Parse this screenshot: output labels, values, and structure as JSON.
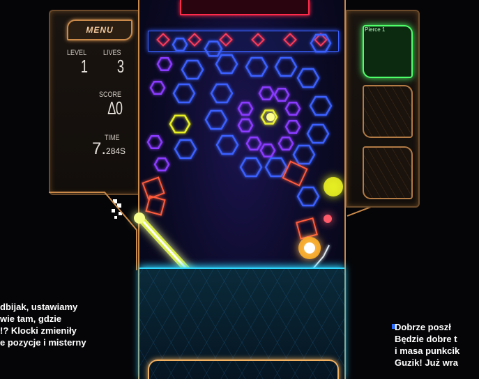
{
  "hud": {
    "menu_label": "MENU",
    "level_label": "LEVEL",
    "level_value": "1",
    "lives_label": "LIVES",
    "lives_value": "3",
    "score_label": "SCORE",
    "score_value": "∆0",
    "time_label": "TIME",
    "time_value_main": "7.",
    "time_value_small": "284S"
  },
  "card": {
    "label": "Pierce 1",
    "icon": "arrow-up-icon"
  },
  "captions": {
    "left": "dbijak, ustawiamy\nwie tam, gdzie\n!? Klocki zmieniły\ne pozycje i misterny",
    "right": "Dobrze poszł\nBędzie dobre t\ni masa punkcik\nGuzik! Już wra"
  },
  "colors": {
    "accent_orange": "#c98a4a",
    "neon_blue": "#3a60ff",
    "neon_purple": "#8a3aff",
    "neon_yellow": "#e8f020",
    "neon_red": "#ff2a4a",
    "neon_green": "#4eff6a",
    "floor_cyan": "#2fd6ff"
  }
}
